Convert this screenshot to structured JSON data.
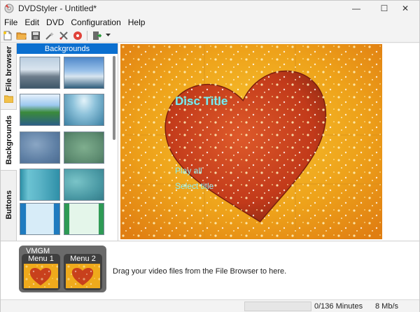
{
  "window": {
    "title": "DVDStyler - Untitled*",
    "minimize_glyph": "—",
    "maximize_glyph": "☐",
    "close_glyph": "✕"
  },
  "menu": {
    "items": [
      "File",
      "Edit",
      "DVD",
      "Configuration",
      "Help"
    ]
  },
  "toolbar": {
    "icons": [
      "new-file-icon",
      "open-folder-icon",
      "save-icon",
      "wizard-icon",
      "settings-icon",
      "burn-icon",
      "export-icon",
      "dropdown-arrow-icon"
    ]
  },
  "tabs": {
    "file_browser": "File browser",
    "backgrounds": "Backgrounds",
    "buttons": "Buttons",
    "active": "Backgrounds"
  },
  "backgrounds_panel": {
    "header": "Backgrounds"
  },
  "canvas": {
    "disc_title": "Disc Title",
    "play_all": "Play all",
    "select_title": "Select title"
  },
  "titleset": {
    "vmgm_label": "VMGM",
    "menus": [
      "Menu 1",
      "Menu 2"
    ],
    "drag_hint": "Drag your video files from the File Browser to here."
  },
  "status": {
    "duration": "0/136 Minutes",
    "bitrate": "8 Mb/s",
    "progress_fraction": 0.0
  },
  "colors": {
    "accent": "#0b6fcf",
    "title_text": "#7fe8f2",
    "heart": "#c63a1f",
    "bg_gold": "#e9a216"
  }
}
